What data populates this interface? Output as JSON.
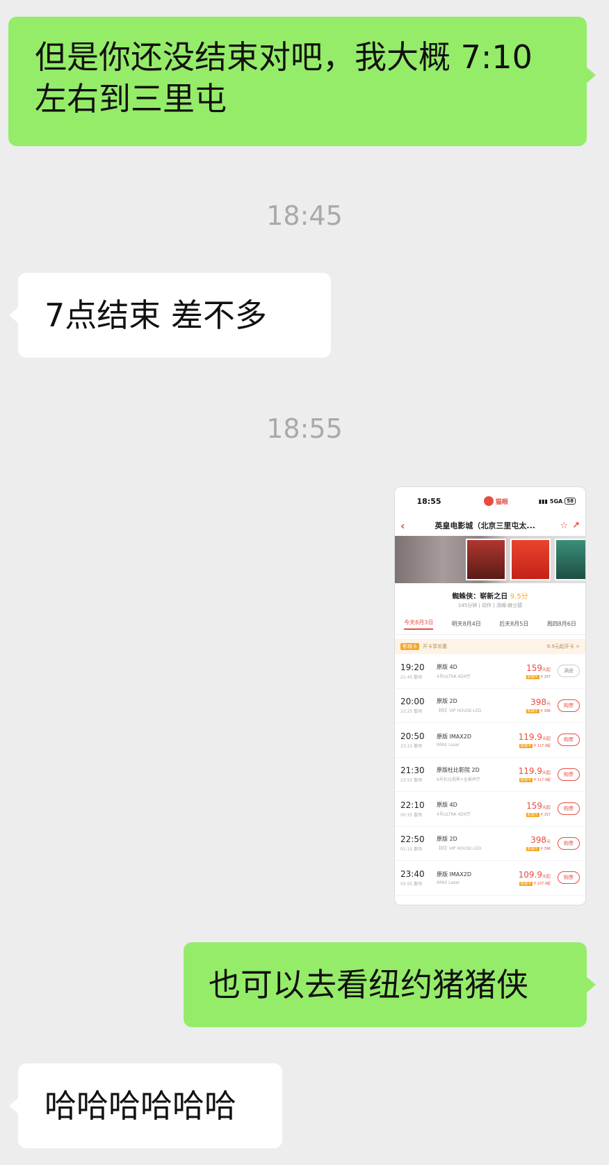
{
  "messages": {
    "m1": {
      "line1": "但是你还没结束对吧，我大概 7:10",
      "line2": "左右到三里屯"
    },
    "ts1": "18:45",
    "m2": "7点结束  差不多",
    "ts2": "18:55",
    "m4": "也可以去看纽约猪猪侠",
    "m5": "哈哈哈哈哈哈"
  },
  "screenshot": {
    "status_time": "18:55",
    "app_name": "猫眼",
    "network": "5GA",
    "battery": "58",
    "cinema_title": "英皇电影城（北京三里屯太...",
    "movie_title": "蜘蛛侠：崭新之日",
    "movie_score": "9.5分",
    "movie_meta": "145分钟 | 动作 | 汤姆·赫兰德",
    "dates": [
      "今天8月3日",
      "明天8月4日",
      "后天8月5日",
      "周四8月6日"
    ],
    "promo_tag": "影城卡",
    "promo_text": "开卡享优惠",
    "promo_right": "9.9元起开卡 >",
    "card_label": "影城卡",
    "showtimes": [
      {
        "start": "19:20",
        "end": "21:45 散场",
        "version": "原版 4D",
        "hall": "4号ULTRA 4DX厅",
        "price": "159",
        "unit": "元起",
        "card_price": "¥ 157",
        "button": "满座"
      },
      {
        "start": "20:00",
        "end": "22:25 散场",
        "version": "原版 2D",
        "hall": "【旺】VIP HOUSE-LED",
        "price": "398",
        "unit": "元",
        "card_price": "¥ 396",
        "button": "购票"
      },
      {
        "start": "20:50",
        "end": "23:15 散场",
        "version": "原版 IMAX2D",
        "hall": "IMAX Laser",
        "price": "119.9",
        "unit": "元起",
        "card_price": "¥ 117.9起",
        "button": "购票"
      },
      {
        "start": "21:30",
        "end": "23:55 散场",
        "version": "原版杜比影院 2D",
        "hall": "6号杜比视界+全景声厅",
        "price": "119.9",
        "unit": "元起",
        "card_price": "¥ 117.9起",
        "button": "购票"
      },
      {
        "start": "22:10",
        "end": "00:35 散场",
        "version": "原版 4D",
        "hall": "4号ULTRA 4DX厅",
        "price": "159",
        "unit": "元起",
        "card_price": "¥ 157",
        "button": "购票"
      },
      {
        "start": "22:50",
        "end": "01:15 散场",
        "version": "原版 2D",
        "hall": "【旺】VIP HOUSE-LED",
        "price": "398",
        "unit": "元",
        "card_price": "¥ 396",
        "button": "购票"
      },
      {
        "start": "23:40",
        "end": "02:05 散场",
        "version": "原版 IMAX2D",
        "hall": "IMAX Laser",
        "price": "109.9",
        "unit": "元起",
        "card_price": "¥ 107.9起",
        "button": "购票"
      }
    ]
  },
  "colors": {
    "outgoing": "#95ec69",
    "incoming": "#ffffff",
    "background": "#ededed",
    "accent": "#e54d42"
  }
}
